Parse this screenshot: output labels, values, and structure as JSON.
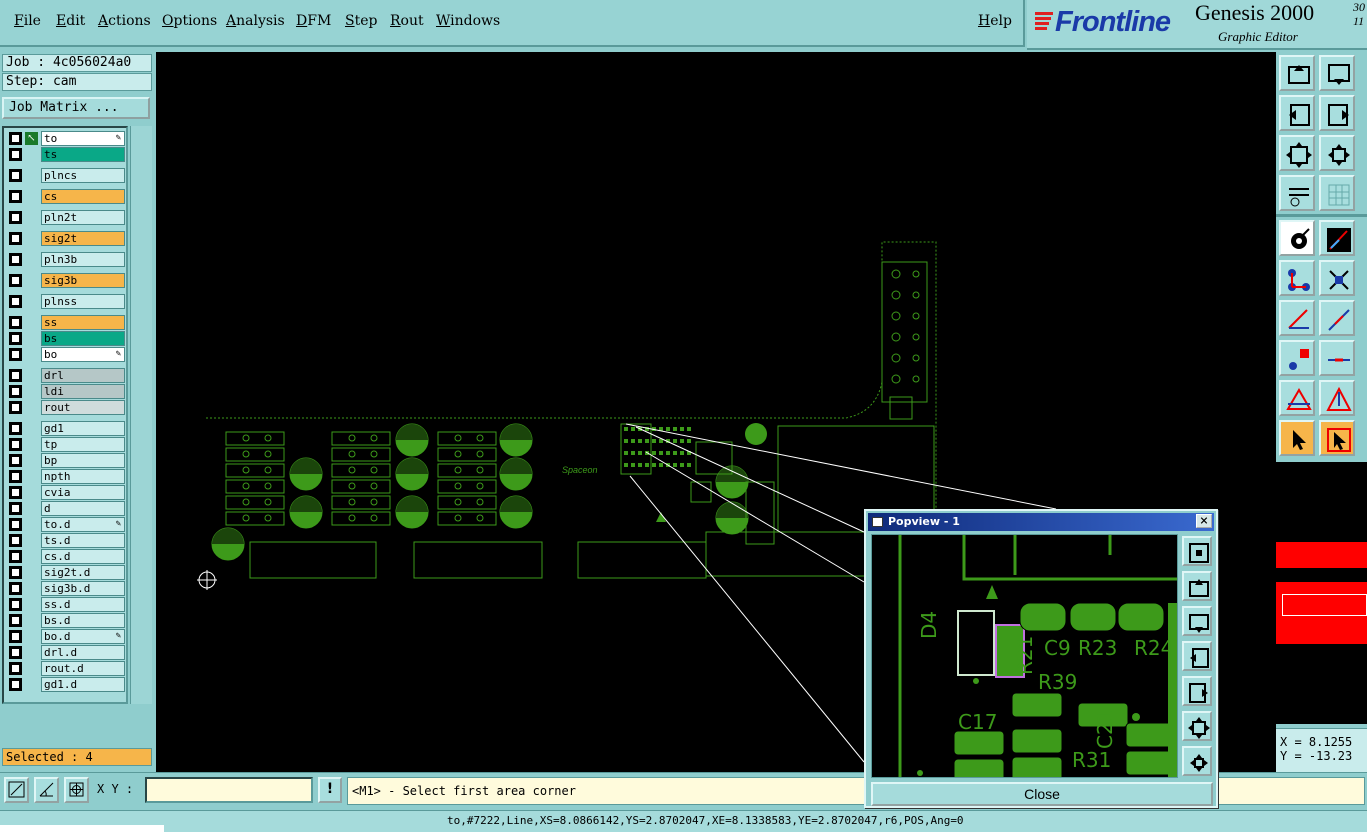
{
  "menu": {
    "items": [
      "File",
      "Edit",
      "Actions",
      "Options",
      "Analysis",
      "DFM",
      "Step",
      "Rout",
      "Windows"
    ],
    "help": "Help"
  },
  "logo": {
    "brand": "Frontline",
    "product": "Genesis 2000",
    "subtitle": "Graphic Editor",
    "version_top": "30",
    "version_bottom": "11"
  },
  "job": {
    "job_label": "Job : 4c056024a0",
    "step_label": "Step: cam",
    "matrix_button": "Job Matrix ..."
  },
  "layers": [
    {
      "name": "to",
      "color": "white",
      "edit": true
    },
    {
      "name": "ts",
      "color": "green"
    },
    {
      "name": "plncs",
      "color": "plain"
    },
    {
      "name": "cs",
      "color": "orange"
    },
    {
      "name": "pln2t",
      "color": "plain"
    },
    {
      "name": "sig2t",
      "color": "orange"
    },
    {
      "name": "pln3b",
      "color": "plain"
    },
    {
      "name": "sig3b",
      "color": "orange"
    },
    {
      "name": "plnss",
      "color": "plain"
    },
    {
      "name": "ss",
      "color": "orange"
    },
    {
      "name": "bs",
      "color": "green"
    },
    {
      "name": "bo",
      "color": "white",
      "edit": true
    },
    {
      "name": "drl",
      "color": "gray"
    },
    {
      "name": "ldi",
      "color": "gray"
    },
    {
      "name": "rout",
      "color": "lgray"
    },
    {
      "name": "gd1",
      "color": "plain"
    },
    {
      "name": "tp",
      "color": "plain"
    },
    {
      "name": "bp",
      "color": "plain"
    },
    {
      "name": "npth",
      "color": "plain"
    },
    {
      "name": "cvia",
      "color": "plain"
    },
    {
      "name": "d",
      "color": "plain"
    },
    {
      "name": "to.d",
      "color": "plain",
      "edit": true
    },
    {
      "name": "ts.d",
      "color": "plain"
    },
    {
      "name": "cs.d",
      "color": "plain"
    },
    {
      "name": "sig2t.d",
      "color": "plain"
    },
    {
      "name": "sig3b.d",
      "color": "plain"
    },
    {
      "name": "ss.d",
      "color": "plain"
    },
    {
      "name": "bs.d",
      "color": "plain"
    },
    {
      "name": "bo.d",
      "color": "plain",
      "edit": true
    },
    {
      "name": "drl.d",
      "color": "plain"
    },
    {
      "name": "rout.d",
      "color": "plain"
    },
    {
      "name": "gd1.d",
      "color": "plain"
    }
  ],
  "selected": "Selected : 4",
  "command": {
    "xy_label": "X Y :",
    "xy_value": "",
    "bang": "!",
    "prompt": "<M1> - Select first area corner"
  },
  "status": "to,#7222,Line,XS=8.0866142,YS=2.8702047,XE=8.1338583,YE=2.8702047,r6,POS,Ang=0",
  "coords": {
    "x": "X = 8.1255",
    "y": "Y = -13.23"
  },
  "popview": {
    "title": "Popview - 1",
    "close_label": "Close",
    "labels": [
      "D4",
      "C9",
      "R23",
      "R24",
      "R21",
      "R39",
      "C17",
      "C21",
      "R31"
    ]
  },
  "canvas": {
    "board_text": "Spaceon"
  },
  "colors": {
    "pcb_green": "#3d9a1a",
    "canvas_bg": "#000000",
    "panel": "#8fcdcd"
  }
}
